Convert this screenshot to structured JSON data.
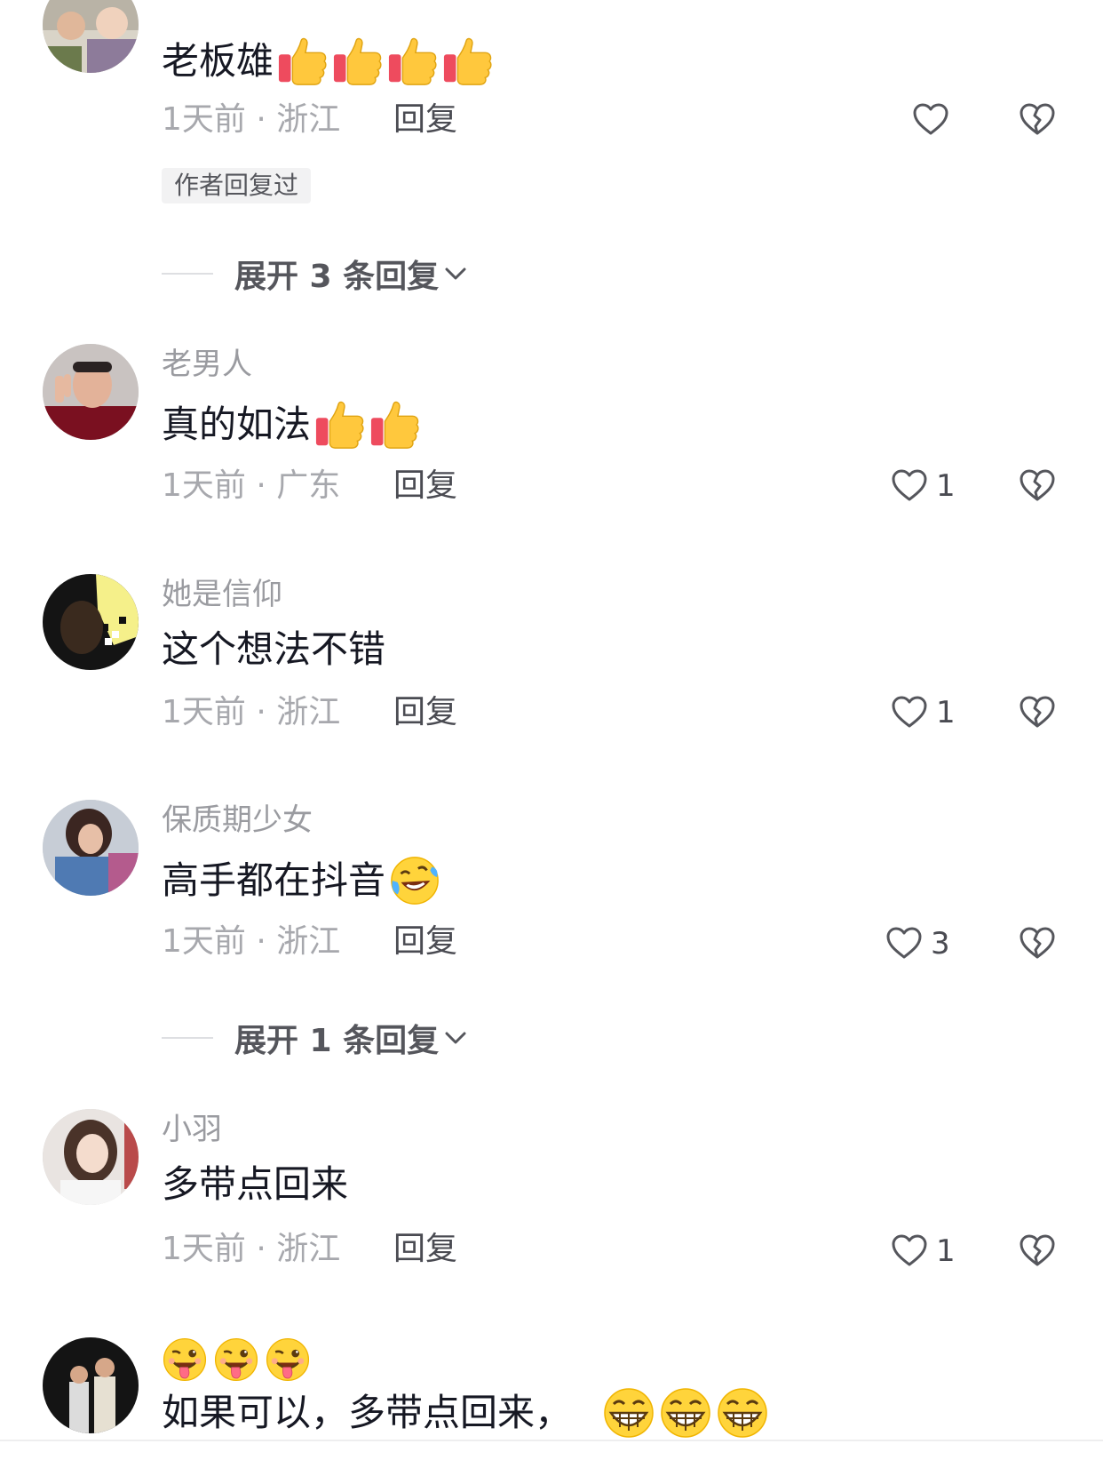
{
  "comments": [
    {
      "username": "",
      "text": "老板雄",
      "emoji_count": 4,
      "emoji": "thumbs-up",
      "time": "1天前",
      "location": "浙江",
      "reply_label": "回复",
      "likes": "",
      "badge": "作者回复过",
      "expand_label": "展开 3 条回复"
    },
    {
      "username": "老男人",
      "text": "真的如法",
      "emoji": "thumbs-up",
      "time": "1天前",
      "location": "广东",
      "reply_label": "回复",
      "likes": "1"
    },
    {
      "username": "她是信仰",
      "text": "这个想法不错",
      "time": "1天前",
      "location": "浙江",
      "reply_label": "回复",
      "likes": "1"
    },
    {
      "username": "保质期少女",
      "text": "高手都在抖音",
      "emoji": "rofl",
      "time": "1天前",
      "location": "浙江",
      "reply_label": "回复",
      "likes": "3",
      "expand_label": "展开 1 条回复"
    },
    {
      "username": "小羽",
      "text": "多带点回来",
      "time": "1天前",
      "location": "浙江",
      "reply_label": "回复",
      "likes": "1"
    },
    {
      "username": "",
      "text": "如果可以，多带点回来，",
      "emoji_top": "tongue-wink",
      "emoji": "grin"
    }
  ],
  "separator": "·",
  "colors": {
    "text_primary": "#161823",
    "text_secondary": "#a7a8ad",
    "username": "#9a9ba0",
    "action": "#4a4b52",
    "badge_bg": "#f2f2f3"
  }
}
